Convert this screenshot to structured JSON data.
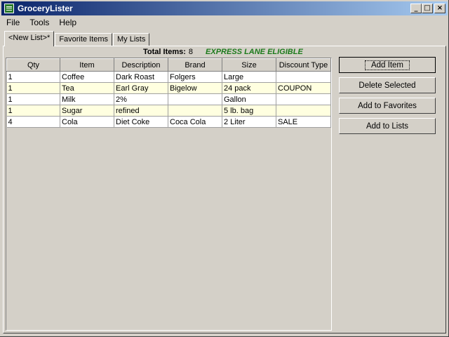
{
  "window": {
    "title": "GroceryLister"
  },
  "title_buttons": {
    "minimize": "_",
    "maximize": "□",
    "close": "×"
  },
  "menu": [
    {
      "label": "File"
    },
    {
      "label": "Tools"
    },
    {
      "label": "Help"
    }
  ],
  "tabs": [
    {
      "label": "<New List>*",
      "active": true
    },
    {
      "label": "Favorite Items",
      "active": false
    },
    {
      "label": "My Lists",
      "active": false
    }
  ],
  "summary": {
    "total_label": "Total Items:",
    "total_value": "8",
    "express": "EXPRESS LANE ELIGIBLE"
  },
  "table": {
    "columns": [
      "Qty",
      "Item",
      "Description",
      "Brand",
      "Size",
      "Discount Type"
    ],
    "rows": [
      [
        "1",
        "Coffee",
        "Dark Roast",
        "Folgers",
        "Large",
        ""
      ],
      [
        "1",
        "Tea",
        "Earl Gray",
        "Bigelow",
        "24 pack",
        "COUPON"
      ],
      [
        "1",
        "Milk",
        "2%",
        "",
        "Gallon",
        ""
      ],
      [
        "1",
        "Sugar",
        "refined",
        "",
        "5 lb. bag",
        ""
      ],
      [
        "4",
        "Cola",
        "Diet Coke",
        "Coca Cola",
        "2 Liter",
        "SALE"
      ]
    ]
  },
  "buttons": {
    "add_item": "Add Item",
    "delete_selected": "Delete Selected",
    "add_favorites": "Add to Favorites",
    "add_lists": "Add to Lists"
  },
  "colors": {
    "title_gradient_start": "#0a246a",
    "express_green": "#1b7a1b",
    "row_alt": "#ffffe0"
  }
}
